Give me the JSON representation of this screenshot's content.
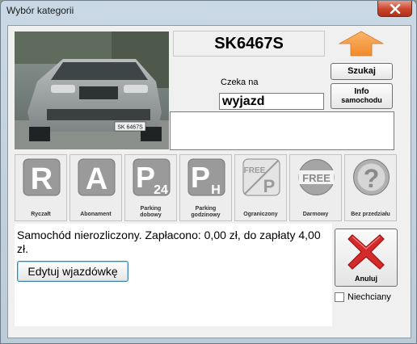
{
  "window": {
    "title": "Wybór kategorii"
  },
  "vehicle": {
    "plate": "SK6467S",
    "photo_plate": "SK 6467S"
  },
  "actions": {
    "search_label": "Szukaj",
    "info_label_line1": "Info",
    "info_label_line2": "samochodu"
  },
  "waiting": {
    "label": "Czeka na",
    "value": "wyjazd"
  },
  "categories": [
    {
      "name": "Ryczałt",
      "icon": "r-letter-icon",
      "glyph": "R"
    },
    {
      "name": "Abonament",
      "icon": "a-letter-icon",
      "glyph": "A"
    },
    {
      "name": "Parking dobowy",
      "line1": "Parking",
      "line2": "dobowy",
      "icon": "parking-24-icon",
      "glyph": "P",
      "sub": "24"
    },
    {
      "name": "Parking godzinowy",
      "line1": "Parking",
      "line2": "godzinowy",
      "icon": "parking-hourly-icon",
      "glyph": "P",
      "sub": "H"
    },
    {
      "name": "Ograniczony",
      "icon": "free-parking-limited-icon",
      "glyph": "FREE",
      "sub": "P"
    },
    {
      "name": "Darmowy",
      "icon": "free-icon",
      "glyph": "FREE"
    },
    {
      "name": "Bez przedziału",
      "icon": "question-icon",
      "glyph": "?"
    }
  ],
  "status": {
    "message": "Samochód nierozliczony. Zapłacono: 0,00 zł, do zapłaty 4,00 zł."
  },
  "edit": {
    "label": "Edytuj wjazdówkę"
  },
  "cancel": {
    "label": "Anuluj"
  },
  "ignore": {
    "label": "Niechciany",
    "checked": false
  },
  "colors": {
    "accent_arrow": "#f5a04a",
    "cancel_x": "#d42a2a",
    "icon_gray": "#9a9a9a"
  }
}
